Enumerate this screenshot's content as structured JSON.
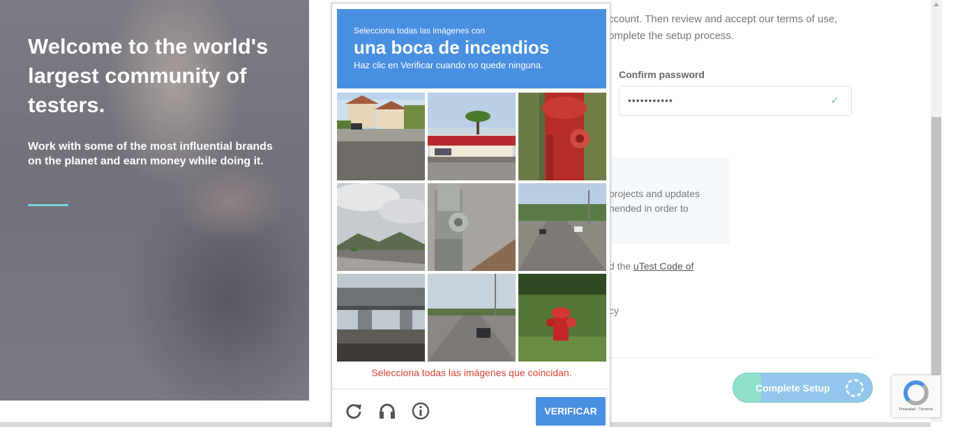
{
  "hero": {
    "title": "Welcome to the world's largest community of testers.",
    "subtitle": "Work with some of the most influential brands on the planet and earn money while doing it."
  },
  "form": {
    "intro": "ccount. Then review and accept our terms of use, omplete the setup process.",
    "confirm_label": "Confirm password",
    "confirm_value": "•••••••••••",
    "info_text": "projects and updates nended in order to",
    "code_prefix": "d the ",
    "code_link": "uTest Code of",
    "policy_fragment": "cy",
    "complete_button": "Complete Setup"
  },
  "captcha": {
    "header_line1": "Selecciona todas las imágenes con",
    "header_target": "una boca de incendios",
    "header_line3": "Haz clic en Verificar cuando no quede ninguna.",
    "error": "Selecciona todas las imágenes que coincidan.",
    "verify_button": "VERIFICAR",
    "tiles": [
      {
        "subject": "suburban houses street"
      },
      {
        "subject": "store with palm tree"
      },
      {
        "subject": "red fire hydrant closeup"
      },
      {
        "subject": "cloudy road with hills"
      },
      {
        "subject": "gray fire hydrant closeup"
      },
      {
        "subject": "highway with traffic"
      },
      {
        "subject": "highway overpass"
      },
      {
        "subject": "multi-lane road with car"
      },
      {
        "subject": "red fire hydrant in grass"
      }
    ]
  },
  "recaptcha_badge": {
    "links": "Privacidad - Términos"
  }
}
